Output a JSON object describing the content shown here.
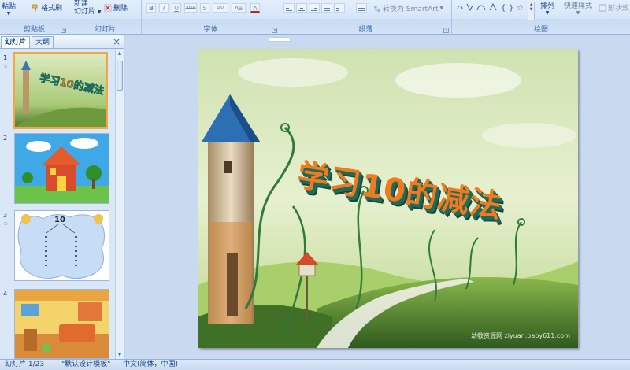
{
  "ribbon": {
    "clipboard": {
      "paste": "粘贴",
      "format_painter": "格式刷",
      "label": "剪贴板"
    },
    "slides": {
      "new_slide_line1": "新建",
      "new_slide_line2": "幻灯片",
      "delete": "删除",
      "label": "幻灯片"
    },
    "font": {
      "label": "字体",
      "bold": "B",
      "italic": "I",
      "underline": "U",
      "strike": "abe",
      "shadow": "S",
      "spacing": "AV",
      "case": "Aa",
      "color": "A"
    },
    "paragraph": {
      "label": "段落",
      "smartart": "转换为 SmartArt"
    },
    "drawing": {
      "label": "绘图",
      "arrange": "排列",
      "quick_styles": "快速样式",
      "shape_outline": "形状效"
    }
  },
  "left_panel": {
    "tabs": {
      "slides": "幻灯片",
      "outline": "大纲"
    },
    "close": "×",
    "slides": [
      {
        "number": "1",
        "title": "学习10的减法"
      },
      {
        "number": "2"
      },
      {
        "number": "3",
        "title": "10"
      },
      {
        "number": "4"
      }
    ]
  },
  "slide": {
    "title": "学习10的减法",
    "watermark": "幼教资源网 ziyuan.baby611.com"
  },
  "statusbar": {
    "slide_info": "幻灯片 1/23",
    "theme": "\"默认设计模板\"",
    "language": "中文(简体，中国)"
  },
  "colors": {
    "accent": "#f2a648",
    "ribbon_text": "#15428b",
    "title_front": "#f27a1e",
    "title_side": "#1f6b5a"
  }
}
